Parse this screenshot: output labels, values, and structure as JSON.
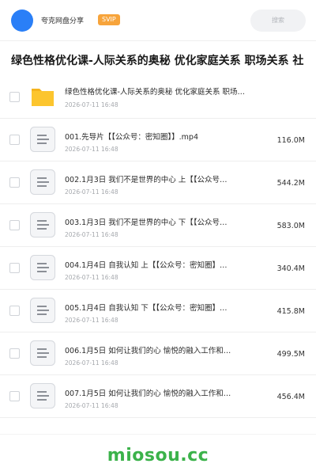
{
  "header": {
    "app_title": "夸克网盘分享",
    "badge": "SVIP",
    "search_placeholder": "搜索"
  },
  "page_title": "绿色性格优化课-人际关系的奥秘 优化家庭关系 职场关系 社",
  "files": [
    {
      "type": "folder",
      "name": "绿色性格优化课-人际关系的奥秘 优化家庭关系 职场…",
      "date": "2026-07-11 16:48",
      "size": ""
    },
    {
      "type": "file",
      "name": "001.先导片【【公众号：密知圈】】.mp4",
      "date": "2026-07-11 16:48",
      "size": "116.0M"
    },
    {
      "type": "file",
      "name": "002.1月3日 我们不是世界的中心 上【【公众号…",
      "date": "2026-07-11 16:48",
      "size": "544.2M"
    },
    {
      "type": "file",
      "name": "003.1月3日 我们不是世界的中心 下【【公众号…",
      "date": "2026-07-11 16:48",
      "size": "583.0M"
    },
    {
      "type": "file",
      "name": "004.1月4日 自我认知 上【【公众号：密知圈】…",
      "date": "2026-07-11 16:48",
      "size": "340.4M"
    },
    {
      "type": "file",
      "name": "005.1月4日 自我认知 下【【公众号：密知圈】…",
      "date": "2026-07-11 16:48",
      "size": "415.8M"
    },
    {
      "type": "file",
      "name": "006.1月5日 如何让我们的心 愉悦的融入工作和…",
      "date": "2026-07-11 16:48",
      "size": "499.5M"
    },
    {
      "type": "file",
      "name": "007.1月5日 如何让我们的心 愉悦的融入工作和…",
      "date": "2026-07-11 16:48",
      "size": "456.4M"
    }
  ],
  "watermark": "miosou.cc",
  "colors": {
    "avatar": "#2a7ff7",
    "svip_badge": "#f7a43b",
    "folder": "#fcc52e",
    "watermark": "#3bb24a"
  },
  "icons": {
    "folder": "folder-icon",
    "file": "document-icon"
  }
}
